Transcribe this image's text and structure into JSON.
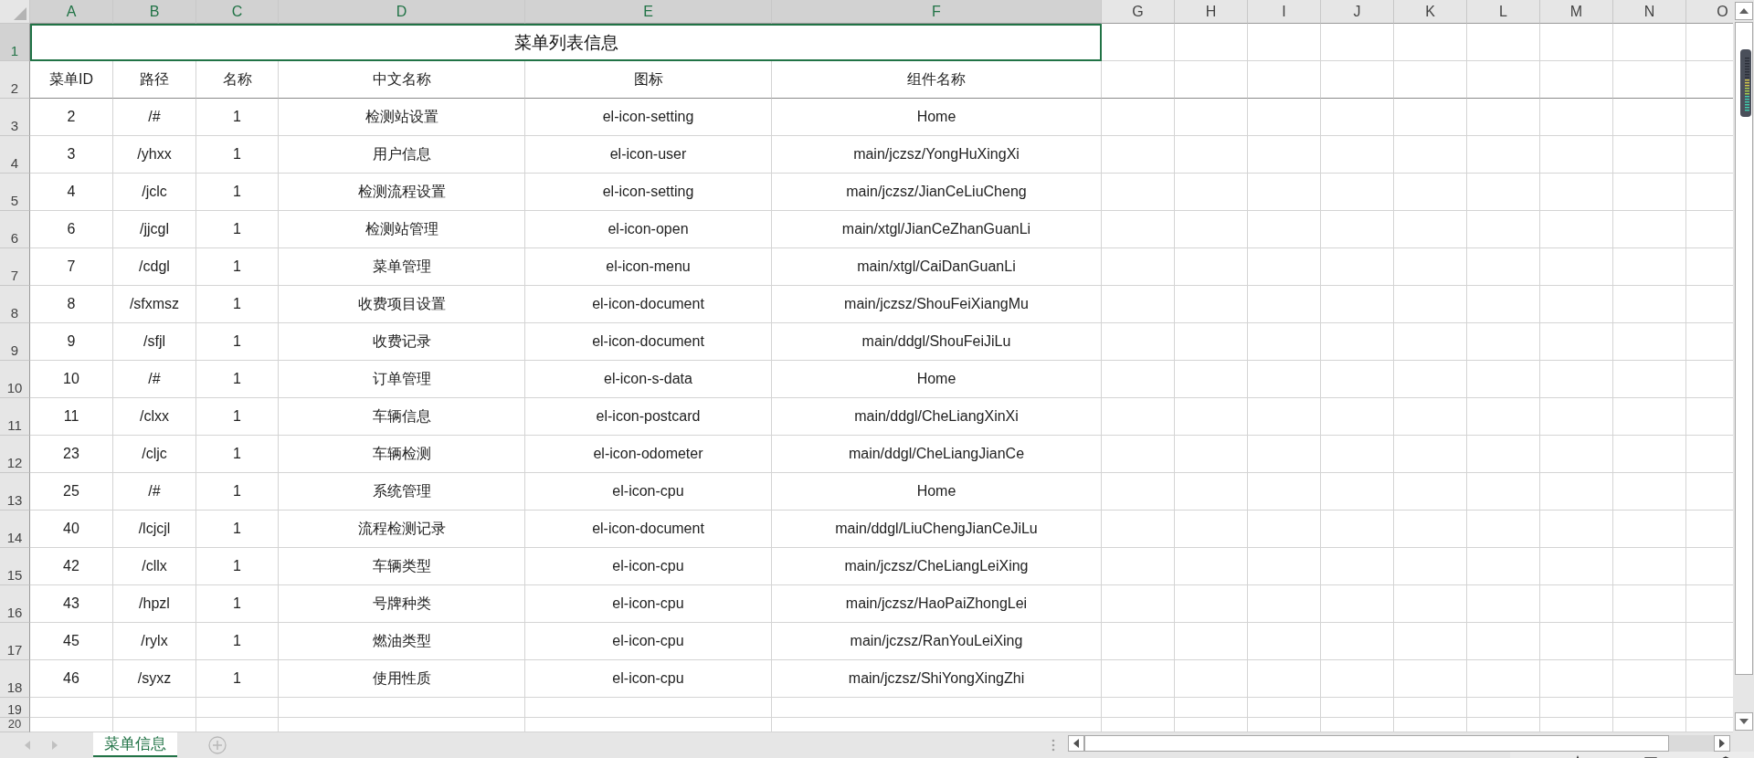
{
  "columns": [
    {
      "label": "A",
      "selected": true
    },
    {
      "label": "B",
      "selected": true
    },
    {
      "label": "C",
      "selected": true
    },
    {
      "label": "D",
      "selected": true
    },
    {
      "label": "E",
      "selected": true
    },
    {
      "label": "F",
      "selected": true
    },
    {
      "label": "G",
      "selected": false
    },
    {
      "label": "H",
      "selected": false
    },
    {
      "label": "I",
      "selected": false
    },
    {
      "label": "J",
      "selected": false
    },
    {
      "label": "K",
      "selected": false
    },
    {
      "label": "L",
      "selected": false
    },
    {
      "label": "M",
      "selected": false
    },
    {
      "label": "N",
      "selected": false
    },
    {
      "label": "O",
      "selected": false
    }
  ],
  "row_numbers": [
    {
      "label": "1",
      "selected": true
    },
    {
      "label": "2",
      "selected": false
    },
    {
      "label": "3",
      "selected": false
    },
    {
      "label": "4",
      "selected": false
    },
    {
      "label": "5",
      "selected": false
    },
    {
      "label": "6",
      "selected": false
    },
    {
      "label": "7",
      "selected": false
    },
    {
      "label": "8",
      "selected": false
    },
    {
      "label": "9",
      "selected": false
    },
    {
      "label": "10",
      "selected": false
    },
    {
      "label": "11",
      "selected": false
    },
    {
      "label": "12",
      "selected": false
    },
    {
      "label": "13",
      "selected": false
    },
    {
      "label": "14",
      "selected": false
    },
    {
      "label": "15",
      "selected": false
    },
    {
      "label": "16",
      "selected": false
    },
    {
      "label": "17",
      "selected": false
    },
    {
      "label": "18",
      "selected": false
    },
    {
      "label": "19",
      "selected": false
    },
    {
      "label": "20",
      "selected": false
    }
  ],
  "title": {
    "text": "菜单列表信息",
    "selected": true
  },
  "header": [
    "菜单ID",
    "路径",
    "名称",
    "中文名称",
    "图标",
    "组件名称"
  ],
  "rows": [
    [
      "2",
      "/#",
      "1",
      "检测站设置",
      "el-icon-setting",
      "Home"
    ],
    [
      "3",
      "/yhxx",
      "1",
      "用户信息",
      "el-icon-user",
      "main/jczsz/YongHuXingXi"
    ],
    [
      "4",
      "/jclc",
      "1",
      "检测流程设置",
      "el-icon-setting",
      "main/jczsz/JianCeLiuCheng"
    ],
    [
      "6",
      "/jjcgl",
      "1",
      "检测站管理",
      "el-icon-open",
      "main/xtgl/JianCeZhanGuanLi"
    ],
    [
      "7",
      "/cdgl",
      "1",
      "菜单管理",
      "el-icon-menu",
      "main/xtgl/CaiDanGuanLi"
    ],
    [
      "8",
      "/sfxmsz",
      "1",
      "收费项目设置",
      "el-icon-document",
      "main/jczsz/ShouFeiXiangMu"
    ],
    [
      "9",
      "/sfjl",
      "1",
      "收费记录",
      "el-icon-document",
      "main/ddgl/ShouFeiJiLu"
    ],
    [
      "10",
      "/#",
      "1",
      "订单管理",
      "el-icon-s-data",
      "Home"
    ],
    [
      "11",
      "/clxx",
      "1",
      "车辆信息",
      "el-icon-postcard",
      "main/ddgl/CheLiangXinXi"
    ],
    [
      "23",
      "/cljc",
      "1",
      "车辆检测",
      "el-icon-odometer",
      "main/ddgl/CheLiangJianCe"
    ],
    [
      "25",
      "/#",
      "1",
      "系统管理",
      "el-icon-cpu",
      "Home"
    ],
    [
      "40",
      "/lcjcjl",
      "1",
      "流程检测记录",
      "el-icon-document",
      "main/ddgl/LiuChengJianCeJiLu"
    ],
    [
      "42",
      "/cllx",
      "1",
      "车辆类型",
      "el-icon-cpu",
      "main/jczsz/CheLiangLeiXing"
    ],
    [
      "43",
      "/hpzl",
      "1",
      "号牌种类",
      "el-icon-cpu",
      "main/jczsz/HaoPaiZhongLei"
    ],
    [
      "45",
      "/rylx",
      "1",
      "燃油类型",
      "el-icon-cpu",
      "main/jczsz/RanYouLeiXing"
    ],
    [
      "46",
      "/syxz",
      "1",
      "使用性质",
      "el-icon-cpu",
      "main/jczsz/ShiYongXingZhi"
    ]
  ],
  "sheet_tabs": [
    {
      "label": "菜单信息",
      "selected": true
    }
  ]
}
